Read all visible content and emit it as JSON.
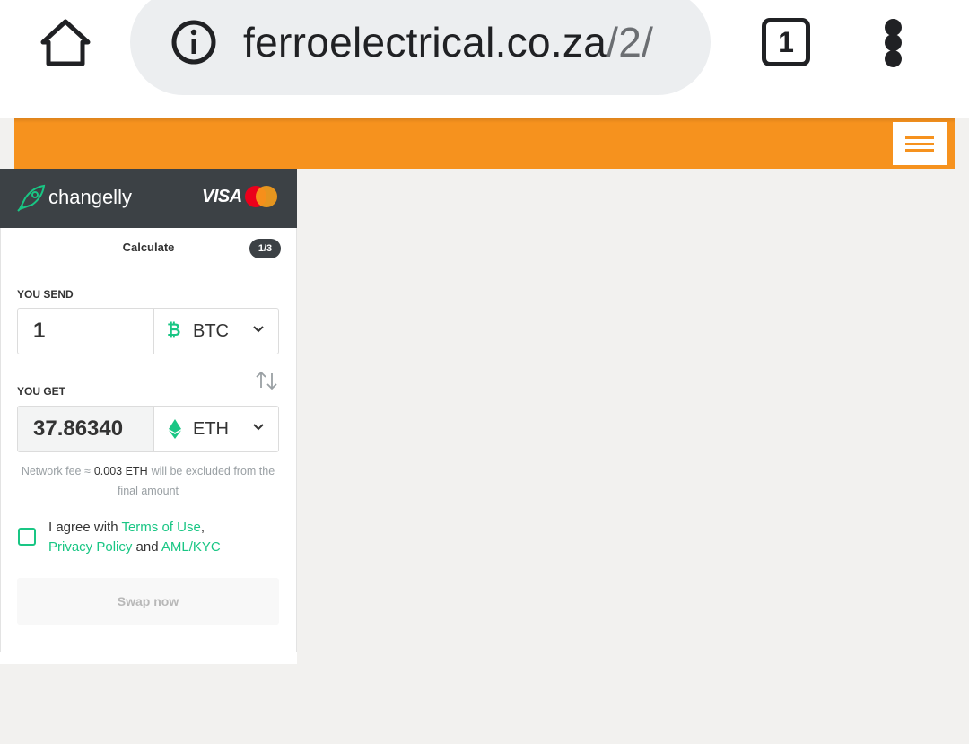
{
  "browser": {
    "url_domain": "ferroelectrical.co.za",
    "url_path": "/2/",
    "tab_count": "1"
  },
  "widget": {
    "brand": "changelly",
    "card_brand": "VISA",
    "step_title": "Calculate",
    "step_badge": "1/3",
    "send_label": "YOU SEND",
    "send_amount": "1",
    "send_currency": "BTC",
    "get_label": "YOU GET",
    "get_amount": "37.86340",
    "get_currency": "ETH",
    "fee_prefix": "Network fee ≈",
    "fee_value": "0.003 ETH",
    "fee_suffix": "will be excluded from the final amount",
    "agree_prefix": "I agree with",
    "terms_link": "Terms of Use",
    "privacy_link": "Privacy Policy",
    "and_text": "and",
    "aml_link": "AML/KYC",
    "swap_button": "Swap now"
  },
  "colors": {
    "accent_orange": "#f6921e",
    "widget_header": "#3c4145",
    "changelly_green": "#19c684"
  }
}
